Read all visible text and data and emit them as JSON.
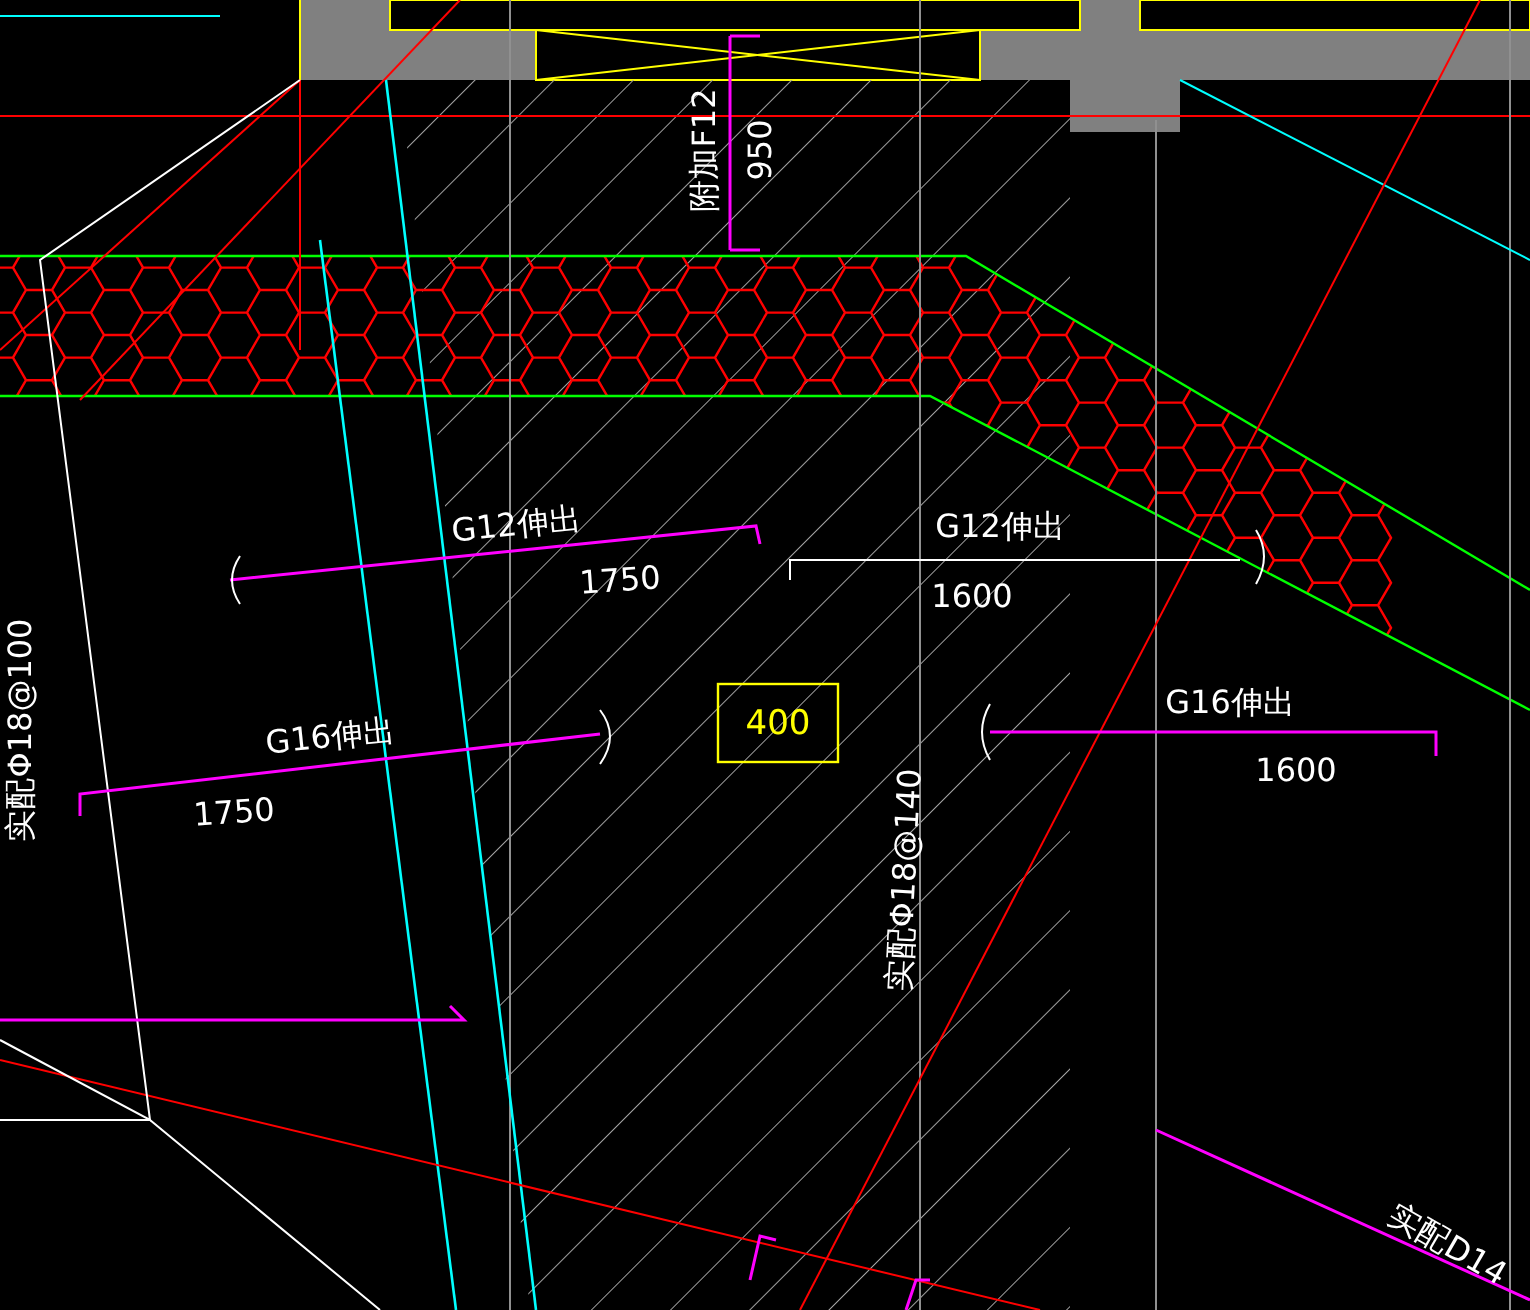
{
  "viewport": {
    "labels": [
      {
        "text": "附加F12",
        "kind": "vertical"
      },
      {
        "text": "950",
        "kind": "vertical"
      },
      {
        "text": "G12伸出",
        "kind": "note"
      },
      {
        "text": "1750",
        "kind": "note"
      },
      {
        "text": "G12伸出",
        "kind": "note"
      },
      {
        "text": "1600",
        "kind": "note"
      },
      {
        "text": "G16伸出",
        "kind": "note"
      },
      {
        "text": "1750",
        "kind": "note"
      },
      {
        "text": "400",
        "kind": "boxed"
      },
      {
        "text": "G16伸出",
        "kind": "note"
      },
      {
        "text": "1600",
        "kind": "note"
      },
      {
        "text": "实配Φ18@140",
        "kind": "vertical"
      },
      {
        "text": "实配Φ18@100",
        "kind": "vertical"
      },
      {
        "text": "实配D14",
        "kind": "note"
      }
    ]
  }
}
